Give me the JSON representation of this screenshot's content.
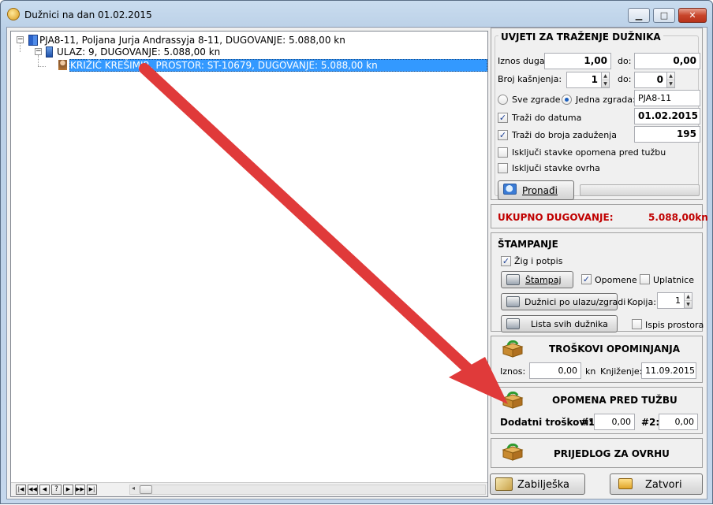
{
  "window": {
    "title": "Dužnici na dan 01.02.2015"
  },
  "tree": {
    "root": "PJA8-11,  Poljana Jurja Andrassyja 8-11,   DUGOVANJE: 5.088,00 kn",
    "child": "ULAZ: 9,   DUGOVANJE: 5.088,00 kn",
    "leaf": "KRIŽIĆ KREŠIMIR,   PROSTOR: ST-10679,   DUGOVANJE: 5.088,00 kn",
    "nav": [
      "|◀",
      "◀◀",
      "◀",
      "?",
      "▶",
      "▶▶",
      "▶|"
    ]
  },
  "search": {
    "title": "UVJETI ZA TRAŽENJE DUŽNIKA",
    "iznos_label": "Iznos duga:",
    "iznos_from": "1,00",
    "do_label": "do:",
    "iznos_to": "0,00",
    "broj_label": "Broj kašnjenja:",
    "broj_from": "1",
    "broj_to": "0",
    "sve_label": "Sve zgrade",
    "jedna_label": "Jedna zgrada:",
    "zgrada": "PJA8-11",
    "trazi_datum_label": "Traži do datuma",
    "datum": "01.02.2015",
    "trazi_broj_label": "Traži do broja zaduženja",
    "broj_zaduzenja": "195",
    "iskljuci_opomena": "Isključi stavke opomena pred tužbu",
    "iskljuci_ovrha": "Isključi stavke ovrha",
    "pronadi": "Pronađi",
    "check": "✓"
  },
  "total": {
    "label": "UKUPNO DUGOVANJE:",
    "value": "5.088,00kn",
    "color": "#c00000"
  },
  "print": {
    "title": "ŠTAMPANJE",
    "zig": "Žig i potpis",
    "stampaj": "Štampaj",
    "opomene": "Opomene",
    "uplatnice": "Uplatnice",
    "duznici_ulaz": "Dužnici po ulazu/zgradi",
    "kopija_label": "Kopija:",
    "kopija": "1",
    "lista": "Lista svih dužnika",
    "ispis": "Ispis prostora"
  },
  "troskovi": {
    "title": "TROŠKOVI OPOMINJANJA",
    "iznos_label": "Iznos:",
    "iznos": "0,00",
    "kn": "kn",
    "knjizenje_label": "Knjiženje:",
    "knjizenje": "11.09.2015"
  },
  "opomena": {
    "title": "OPOMENA PRED TUŽBU",
    "dodatni": "Dodatni troškovi:",
    "n1": "#1",
    "v1": "0,00",
    "n2": "#2:",
    "v2": "0,00"
  },
  "ovrha": {
    "title": "PRIJEDLOG ZA OVRHU"
  },
  "footer": {
    "biljeska": "Zabilješka",
    "zatvori": "Zatvori"
  },
  "arrow_color": "#e03a3a"
}
